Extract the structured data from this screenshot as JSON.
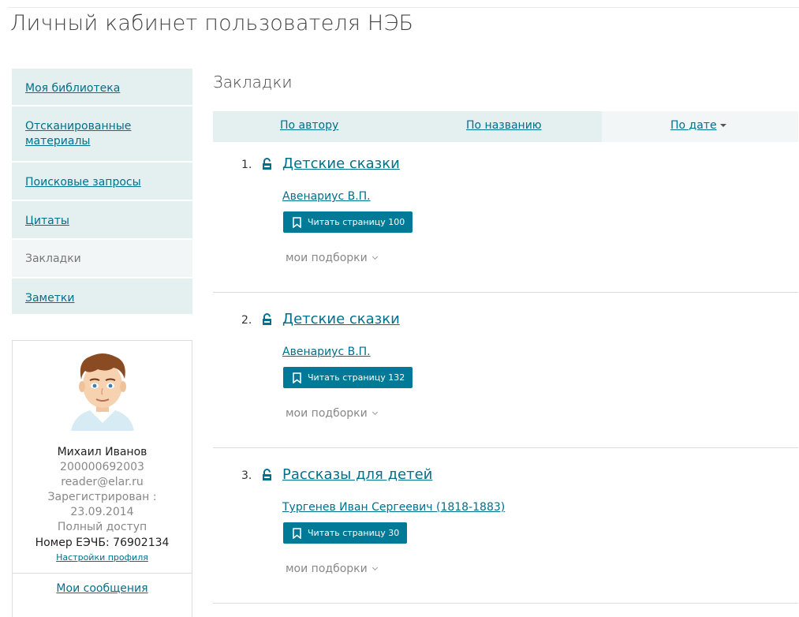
{
  "header": {
    "title": "Личный кабинет пользователя НЭБ"
  },
  "sidebar": {
    "items": [
      {
        "label": "Моя библиотека",
        "active": false
      },
      {
        "label": "Отсканированные материалы",
        "active": false
      },
      {
        "label": "Поисковые запросы",
        "active": false
      },
      {
        "label": "Цитаты",
        "active": false
      },
      {
        "label": "Закладки",
        "active": true
      },
      {
        "label": "Заметки",
        "active": false
      }
    ]
  },
  "profile": {
    "name": "Михаил Иванов",
    "card_number": "200000692003",
    "email": "reader@elar.ru",
    "registered_label": "Зарегистрирован :",
    "registered_date": "23.09.2014",
    "access": "Полный доступ",
    "eechb": "Номер ЕЭЧБ: 76902134",
    "settings_link": "Настройки профиля",
    "messages_link": "Мои сообщения"
  },
  "main": {
    "section_title": "Закладки",
    "sort": {
      "by_author": "По автору",
      "by_title": "По названию",
      "by_date": "По дате"
    },
    "items": [
      {
        "num": "1.",
        "title": "Детские сказки",
        "author": "Авенариус В.П.",
        "button": "Читать страницу 100",
        "collections": "мои подборки"
      },
      {
        "num": "2.",
        "title": "Детские сказки",
        "author": "Авенариус В.П.",
        "button": "Читать страницу 132",
        "collections": "мои подборки"
      },
      {
        "num": "3.",
        "title": "Рассказы для детей",
        "author": "Тургенев Иван Сергеевич (1818-1883)",
        "button": "Читать страницу 30",
        "collections": "мои подборки"
      }
    ]
  },
  "colors": {
    "accent": "#00708b",
    "button": "#007a96",
    "menu_bg": "#e4eff0",
    "active_bg": "#f2f6f6"
  }
}
